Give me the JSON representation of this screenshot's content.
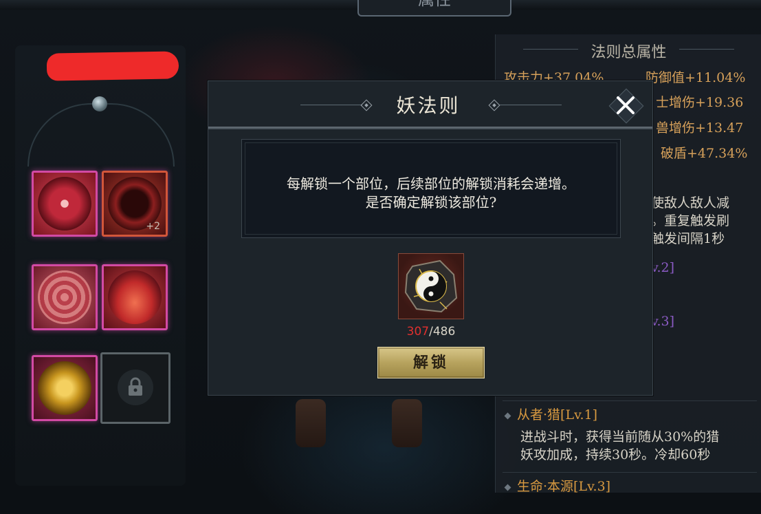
{
  "window": {
    "top_tab_title": "属性"
  },
  "left_panel": {
    "slots": [
      {
        "name": "slot-1",
        "badge": "",
        "color": "#c0283a"
      },
      {
        "name": "slot-2",
        "badge": "+2",
        "color": "#8c1f1f"
      },
      {
        "name": "slot-3",
        "badge": "",
        "color": "#b83a46"
      },
      {
        "name": "slot-4",
        "badge": "",
        "color": "#c12a2a"
      },
      {
        "name": "slot-5",
        "badge": "",
        "color": "#c8961f"
      },
      {
        "name": "slot-6",
        "badge": "",
        "locked": true
      }
    ],
    "accent_color": "#d24aa4"
  },
  "right_panel": {
    "title": "法则总属性",
    "stats": [
      {
        "label": "攻击力+37.04%"
      },
      {
        "label": "防御值+11.04%"
      },
      {
        "label": "士增伤+19.36"
      },
      {
        "label": "兽增伤+13.47"
      },
      {
        "label": "破盾+47.34%"
      }
    ],
    "partial_desc": [
      "使敌人敌人减",
      "。重复触发刷",
      "触发间隔1秒"
    ],
    "partial_levels": [
      "v.2]",
      "v.3]"
    ],
    "skills": [
      {
        "name": "从者·猎",
        "level": "[Lv.1]",
        "desc_lines": [
          "进战斗时，获得当前随从30%的猎",
          "妖攻加成，持续30秒。冷却60秒"
        ]
      },
      {
        "name": "生命·本源",
        "level": "[Lv.3]",
        "desc_lines": []
      }
    ]
  },
  "modal": {
    "title": "妖法则",
    "message_line_1": "每解锁一个部位，后续部位的解锁消耗会递增。",
    "message_line_2": "是否确定解锁该部位?",
    "item": {
      "icon": "yin-yang-stone-icon",
      "have": "307",
      "need": "/486"
    },
    "unlock_label": "解锁",
    "close_icon": "close-x-icon"
  },
  "colors": {
    "stat_gold": "#d7a15a",
    "insufficient_red": "#e0302e",
    "button_gold": "#c9b673"
  }
}
